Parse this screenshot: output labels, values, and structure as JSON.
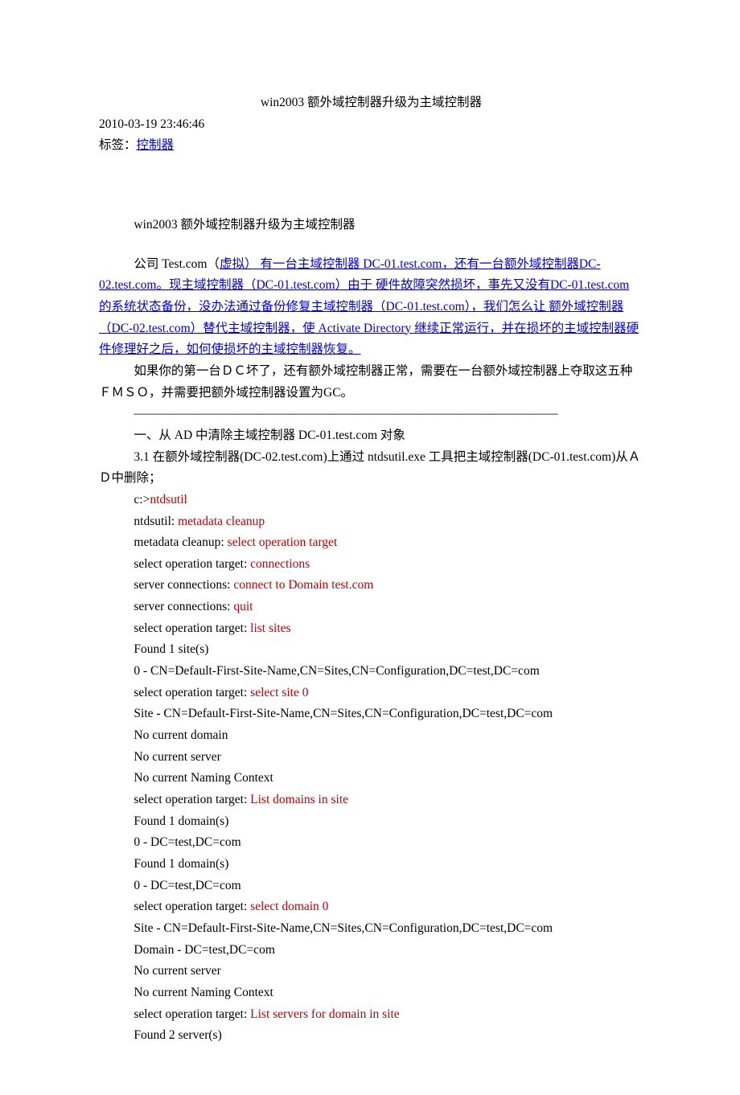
{
  "title": "win2003 额外域控制器升级为主域控制器",
  "timestamp": "2010-03-19 23:46:46",
  "tag_label": "标签：",
  "tag_link": "控制器",
  "subtitle": "win2003 额外域控制器升级为主域控制器",
  "intro_leading": "公司 Test.com（",
  "intro_vlink": "虚拟） 有一台主域控制器 DC-01.test.com，还有一台额外域控制器DC-02.test.com。现主域控制器（DC-01.test.com）由于 硬件故障突然损坏，事先又没有DC-01.test.com 的系统状态备份，没办法通过备份修复主域控制器（DC-01.test.com），我们怎么让 额外域控制器（DC-02.test.com）替代主域控制器，使 Activate Directory 继续正常运行，并在损坏的主域控制器硬件修理好之后，如何使损坏的主域控制器恢复。",
  "explain": "如果你的第一台ＤＣ坏了，还有额外域控制器正常，需要在一台额外域控制器上夺取这五种ＦＭＳＯ，并需要把额外域控制器设置为GC。",
  "sep": "——————————————————————————————————",
  "step1": "一、从 AD 中清除主域控制器 DC-01.test.com 对象",
  "step1_desc": "3.1 在额外域控制器(DC-02.test.com)上通过 ntdsutil.exe 工具把主域控制器(DC-01.test.com)从ＡＤ中删除；",
  "cmd_lines": [
    {
      "pre": "c:>",
      "red": "ntdsutil",
      "post": ""
    },
    {
      "pre": "ntdsutil: ",
      "red": "metadata cleanup",
      "post": ""
    },
    {
      "pre": "metadata cleanup: ",
      "red": "select operation target",
      "post": ""
    },
    {
      "pre": "select operation target: ",
      "red": "connections",
      "post": ""
    },
    {
      "pre": "server connections: ",
      "red": "connect to Domain test.com",
      "post": ""
    },
    {
      "pre": "server connections: ",
      "red": "quit",
      "post": ""
    },
    {
      "pre": "select operation target: ",
      "red": "list sites",
      "post": ""
    },
    {
      "pre": "Found 1 site(s)",
      "red": "",
      "post": ""
    },
    {
      "pre": "0 - CN=Default-First-Site-Name,CN=Sites,CN=Configuration,DC=test,DC=com",
      "red": "",
      "post": ""
    },
    {
      "pre": "select operation target: ",
      "red": "select site 0",
      "post": ""
    },
    {
      "pre": "Site - CN=Default-First-Site-Name,CN=Sites,CN=Configuration,DC=test,DC=com",
      "red": "",
      "post": ""
    },
    {
      "pre": "No current domain",
      "red": "",
      "post": ""
    },
    {
      "pre": "No current server",
      "red": "",
      "post": ""
    },
    {
      "pre": "No current Naming Context",
      "red": "",
      "post": ""
    },
    {
      "pre": "select operation target: ",
      "red": "List domains in site",
      "post": ""
    },
    {
      "pre": "Found 1 domain(s)",
      "red": "",
      "post": ""
    },
    {
      "pre": "0 - DC=test,DC=com",
      "red": "",
      "post": ""
    },
    {
      "pre": "Found 1 domain(s)",
      "red": "",
      "post": ""
    },
    {
      "pre": "0 - DC=test,DC=com",
      "red": "",
      "post": ""
    },
    {
      "pre": "select operation target: ",
      "red": "select domain 0",
      "post": ""
    },
    {
      "pre": "Site - CN=Default-First-Site-Name,CN=Sites,CN=Configuration,DC=test,DC=com",
      "red": "",
      "post": ""
    },
    {
      "pre": "Domain - DC=test,DC=com",
      "red": "",
      "post": ""
    },
    {
      "pre": "No current server",
      "red": "",
      "post": ""
    },
    {
      "pre": "No current Naming Context",
      "red": "",
      "post": ""
    },
    {
      "pre": "select operation target: ",
      "red": "List servers for domain in site",
      "post": ""
    },
    {
      "pre": "Found 2 server(s)",
      "red": "",
      "post": ""
    }
  ]
}
